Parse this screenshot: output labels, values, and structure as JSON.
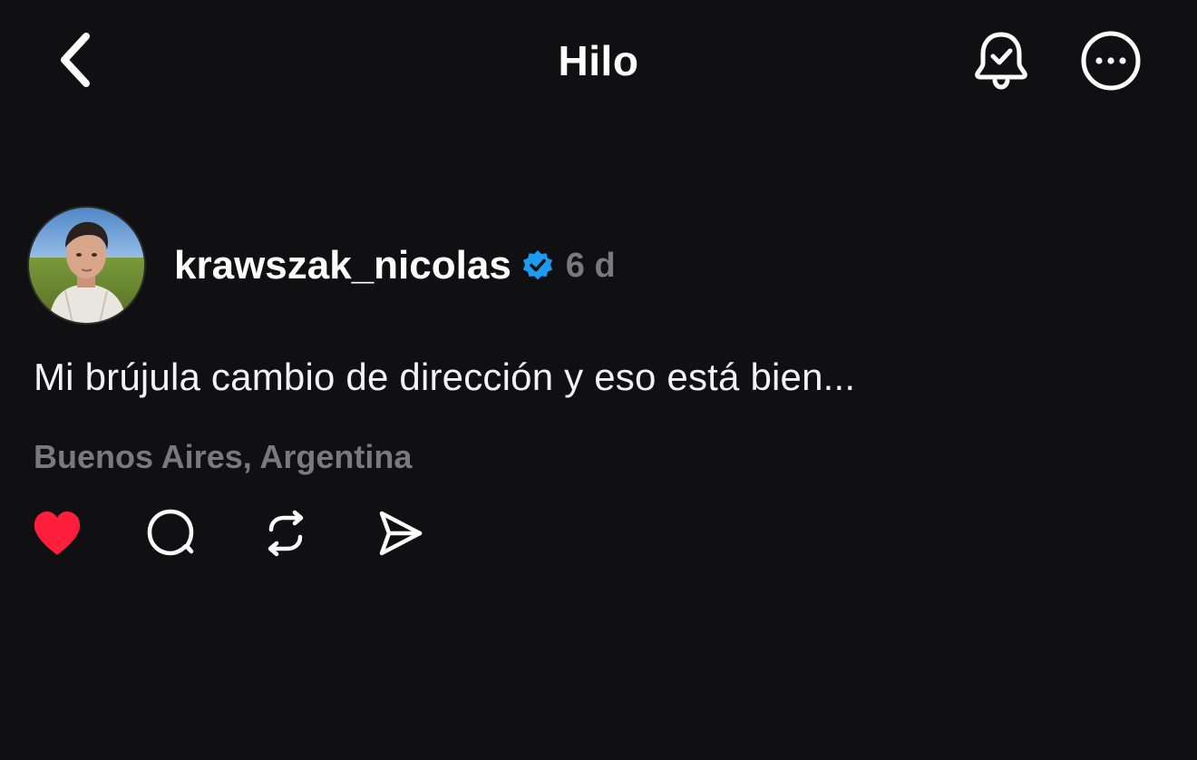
{
  "header": {
    "title": "Hilo",
    "back_icon": "chevron-left-icon",
    "notify_icon": "bell-check-icon",
    "more_icon": "more-horizontal-icon"
  },
  "post": {
    "author": {
      "username": "krawszak_nicolas",
      "verified": true,
      "verified_color": "#1d9bf0"
    },
    "time_ago": "6 d",
    "text": "Mi brújula cambio de dirección y eso está bien...",
    "location": "Buenos Aires, Argentina",
    "liked": true,
    "like_color": "#ff1f3d",
    "actions": [
      {
        "name": "like",
        "icon": "heart-icon"
      },
      {
        "name": "comment",
        "icon": "comment-icon"
      },
      {
        "name": "repost",
        "icon": "repost-icon"
      },
      {
        "name": "share",
        "icon": "send-icon"
      }
    ]
  },
  "colors": {
    "background": "#101012",
    "text_primary": "#ffffff",
    "text_secondary": "#7a7a7e"
  }
}
